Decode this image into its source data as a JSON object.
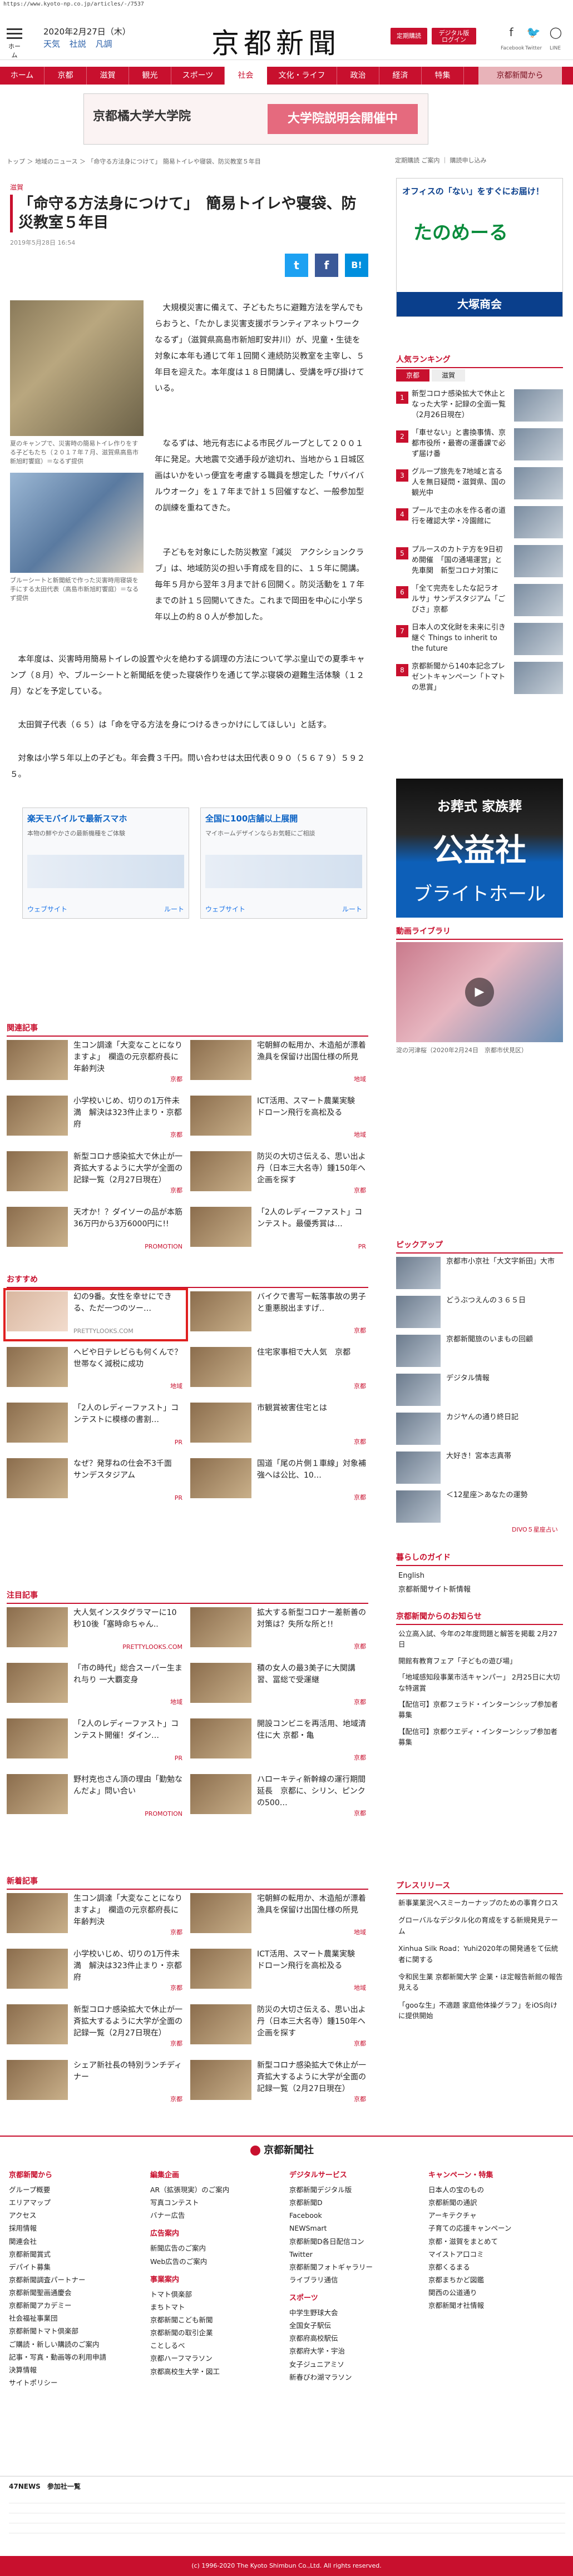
{
  "url": "https://www.kyoto-np.co.jp/articles/-/7537",
  "header": {
    "menu_label": "ホーム",
    "date": "2020年2月27日（木）",
    "weather": [
      "天気",
      "社説",
      "凡調"
    ],
    "logo": "京都新聞",
    "btn_register": "定期購読",
    "btn_digital": "デジタル版 ログイン",
    "social": [
      "Facebook",
      "Twitter",
      "LINE"
    ]
  },
  "nav": [
    "ホーム",
    "京都",
    "滋賀",
    "観光",
    "スポーツ",
    "社会",
    "文化・ライフ",
    "政治",
    "経済",
    "特集",
    "京都新聞から"
  ],
  "top_ad": {
    "left": "京都橘大学大学院",
    "right": "大学院説明会開催中"
  },
  "breadcrumb": "トップ ＞ 地域のニュース ＞ 「命守る方法身につけて」 簡易トイレや寝袋、防災教室５年目",
  "right_top_links": "定期購読 ご案内 ｜ 購読申し込み",
  "article": {
    "category": "滋賀",
    "title": "「命守る方法身につけて」　簡易トイレや寝袋、防災教室５年目",
    "date": "2019年5月28日 16:54",
    "share": [
      "t",
      "f",
      "B!"
    ],
    "caption1": "夏のキャンプで、災害時の簡易トイレ作りをする子どもたち（２０１７年７月、滋賀県高島市新旭町饗庭）＝なるず提供",
    "caption2": "ブルーシートと新聞紙で作った災害時用寝袋を手にする太田代表（高島市新旭町饗庭）＝なるず提供",
    "paragraphs": [
      "大規模災害に備えて、子どもたちに避難方法を学んでもらおうと、「たかしま災害支援ボランティアネットワークなるず」（滋賀県高島市新旭町安井川）が、児童・生徒を対象に本年も通じて年１回開く連続防災教室を主宰し、５年目を迎えた。本年度は１８日開講し、受講を呼び掛けている。",
      "なるずは、地元有志による市民グループとして２００１年に発足。大地震で交通手段が途切れ、当地から１日城区画はいかをいっ便宜を考慮する職員を想定した「サバイバルウオーク」を１７年まで計１５回催すなど、一般参加型の訓練を重ねてきた。",
      "子どもを対象にした防災教室「減災　アクシションクラブ」は、地域防災の担い手育成を目的に、１５年に開講。毎年５月から翌年３月まで計６回開く。防災活動を１７年までの計１５回開いてきた。これまで岡田を中心に小学５年以上の約８０人が参加した。",
      "本年度は、災害時用簡易トイレの設置や火を絶わする調理の方法について学ぶ皇山での夏季キャンプ（８月）や、ブルーシートと新聞紙を使った寝袋作りを通じて学ぶ寝袋の避難生活体験（１２月）などを予定している。",
      "太田賀子代表（６５）は「命を守る方法を身につけるきっかけにしてほしい」と話す。",
      "対象は小学５年以上の子ども。年会費３千円。問い合わせは太田代表０９０（５６７９）５９２５。"
    ]
  },
  "ads_mid": [
    {
      "title": "楽天モバイルで最新スマホ",
      "sub": "本物の鮮やかさの最新機種をご体験",
      "buttons": [
        "ウェブサイト",
        "ルート"
      ]
    },
    {
      "title": "全国に100店舗以上展開",
      "sub": "マイホームデザインならお気軽にご相談",
      "buttons": [
        "ウェブサイト",
        "ルート"
      ]
    }
  ],
  "related": {
    "heading": "関連記事",
    "items": [
      {
        "text": "生コン調達「大変なことになりますよ」　欄造の元京都府長に年齢判決",
        "src": "京都"
      },
      {
        "text": "宅朝鮮の転用か、木造船が漂着　漁具を保留け出国仕様の所見",
        "src": "地域"
      },
      {
        "text": "小学校いじめ、切りの1万件未満　解決は323件止まり・京都府",
        "src": "京都"
      },
      {
        "text": "ICT活用、スマート農業実験　ドローン飛行を高松及る",
        "src": "地域"
      },
      {
        "text": "新型コロナ感染拡大で休止が一斉拡大するように大学が全面の記録一覧（2月27日現在）",
        "src": "京都"
      },
      {
        "text": "防災の大切さ伝える、思い出よ丹（日本三大名寺）鍾150年へ企画を探す",
        "src": "京都"
      },
      {
        "text": "天才か！？ダイソーの品が本筋36万円から3万6000円に!!",
        "src": "PROMOTION"
      },
      {
        "text": "「2人のレディーファスト」コンテスト。最優秀賞は…",
        "src": "PR"
      }
    ]
  },
  "recommend": {
    "heading": "おすすめ",
    "items": [
      {
        "text": "幻の9番。女性を幸せにできる、ただ一つのツー…",
        "src": "PRETTYLOOKS.COM"
      },
      {
        "text": "バイクで書写ー転落事故の男子と重悪脱出ますげ..",
        "src": "京都"
      },
      {
        "text": "ヘビや日テレビらも何くんで？　世帯なく減税に成功",
        "src": "地域"
      },
      {
        "text": "住宅家事相で大人気　京都",
        "src": "京都"
      },
      {
        "text": "「2人のレディーファスト」コンテストに模様の書割…",
        "src": "PR"
      },
      {
        "text": "市観賞被害住宅とは",
        "src": "京都"
      },
      {
        "text": "なぜ？発芽ねの仕会不3千面　サンデスタジアム",
        "src": "PR"
      },
      {
        "text": "国道「尾の片側１車線」対象補強へは公比、10…",
        "src": "京都"
      }
    ]
  },
  "attention": {
    "heading": "注目記事",
    "items": [
      {
        "text": "大人気インスタグラマーに10秒10後「塞時命ちゃん..",
        "src": "PRETTYLOOKS.COM"
      },
      {
        "text": "拡大する新型コロナー差新善の対策は？失所な所と!!",
        "src": "京都"
      },
      {
        "text": "「市の時代」総合スーパー生まれ与り 一大覇変身",
        "src": "地域"
      },
      {
        "text": "積の女人の最3美子に大関講習、冨総で受運継",
        "src": "京都"
      },
      {
        "text": "「2人のレディーファスト」コンテスト開催！ダイン…",
        "src": "PR"
      },
      {
        "text": "開設コンビニを再活用、地域清住に大 京都・亀",
        "src": "京都"
      },
      {
        "text": "野村克也さん頂の理由「勤勉なんだよ」問い合い",
        "src": "PROMOTION"
      },
      {
        "text": "ハローキティ新幹線の運行期間延長　京都に、シリン、ピンクの500…",
        "src": "京都"
      }
    ]
  },
  "newest": {
    "heading": "新着記事",
    "items": [
      {
        "text": "生コン調達「大変なことになりますよ」　欄造の元京都府長に年齢判決",
        "src": "京都"
      },
      {
        "text": "宅朝鮮の転用か、木造船が漂着　漁具を保留け出国仕様の所見",
        "src": "地域"
      },
      {
        "text": "小学校いじめ、切りの1万件未満　解決は323件止まり・京都府",
        "src": "京都"
      },
      {
        "text": "ICT活用、スマート農業実験　ドローン飛行を高松及る",
        "src": "地域"
      },
      {
        "text": "新型コロナ感染拡大で休止が一斉拡大するように大学が全面の記録一覧（2月27日現在）",
        "src": "京都"
      },
      {
        "text": "防災の大切さ伝える、思い出よ丹（日本三大名寺）鍾150年へ企画を探す",
        "src": "京都"
      },
      {
        "text": "シェア新社長の特別ランチディナー",
        "src": "京都"
      },
      {
        "text": "新型コロナ感染拡大で休止が一斉拡大するように大学が全面の記録一覧（2月27日現在）",
        "src": "京都"
      }
    ]
  },
  "sidebar": {
    "ad_top": {
      "line1": "オフィスの「ない」をすぐにお届け！",
      "brand": "たのめーる",
      "company": "大塚商会"
    },
    "ranking_heading": "人気ランキング",
    "ranking_tabs": [
      "京都",
      "滋賀"
    ],
    "ranking": [
      "新型コロナ感染拡大で休止となった大学・記録の全面一覧（2月26日現在）",
      "「車せない」と書換事情、京都市役所・最寄の運番課で必ず届け番",
      "グループ旅先を7地域と言る人を無日疑問・滋賀県、国の観光中",
      "プールで主の水を作る者の道行を確認大学・冷園館に",
      "プルースのカトテ方を9日初め開催　「国の通場運営」と先車関　新型コロナ対策に",
      "「全て完売をしたな記ラオ ルサ」サンデスタジアム「ごびさ」京都",
      "日本人の文化財を未来に引き継ぐ Things to inherit to the future",
      "京都新聞から140本記念プレゼントキャンペーン「トマトの思賞」"
    ],
    "funeral_ad": {
      "top": "お葬式 家族葬",
      "main": "公益社",
      "sub": "ブライトホール"
    },
    "video_heading": "動画ライブラリ",
    "video_caption": "淀の河津桜（2020年2月24日　京都市伏見区）",
    "pickup_heading": "ピックアップ",
    "pickup": [
      "京都市小京社「大文字新田」大市",
      "どうぶつえんの３６５日",
      "京都新聞旅のいまもの回顧",
      "デジタル情報",
      "カジヤんの通り終日記",
      "大好き！宮本志真帯",
      "＜12星座＞あなたの運勢"
    ],
    "pickup_tail": "DIVO５星座占い",
    "guide_heading": "暮らしのガイド",
    "guide": [
      "English",
      "京都新聞サイト新情報"
    ],
    "notice_heading": "京都新聞からのお知らせ",
    "notice": [
      "公立高入試、今年の2年度問題と解答を掲載 2月27日",
      "開館有教育フェア「子どもの遊び場」",
      "「地域感知段事業市活キャンパー」 2月25日に大切な特選賞",
      "【配信可】京都フェラド・インターンシップ参加者募集",
      "【配信可】京都ウエディ・インターンシップ参加者募集"
    ],
    "press_heading": "プレスリリース",
    "press": [
      "新事業業況へスミーカーナップのための事育クロス",
      "グローバルなデジタル化の育成をする新規発見テーム",
      "Xinhua Silk Road：Yuhi2020年の開発通をて伝統者に関する",
      "令和民生業 京都新聞大学 企業・ほ定報告新館の報告見える",
      "「gooな生」不適題 家庭他体操グラフ」をiOS向けに提供開始"
    ]
  },
  "footer": {
    "brand": "京都新聞社",
    "cols": [
      {
        "title": "京都新聞から",
        "items": [
          "グループ概要",
          "エリアマップ",
          "アクセス",
          "採用情報",
          "関連会社",
          "京都新聞賞式",
          "デパイト募集",
          "京都新聞調査パートナー",
          "京都新聞聖画通慶会",
          "京都新聞アカデミー",
          "社会福祉事業団",
          "京都新聞トマト倶楽部",
          "ご購読・新しい購読のご案内",
          "記事・写真・動画等の利用申請",
          "決算情報",
          "サイトポリシー"
        ]
      },
      {
        "title": "編集企画",
        "items": [
          "AR（拡張現実）のご案内",
          "写真コンテスト",
          "バナー広告",
          "",
          "広告案内",
          "新聞広告のご案内",
          "Web広告のご案内",
          "",
          "事業案内",
          "トマト倶楽部",
          "まちトマト",
          "京都新聞こども新聞",
          "京都新聞の取引企業",
          "ことしるべ",
          "京都ハーフマラソン",
          "京都高校生大学・図工"
        ]
      },
      {
        "title": "デジタルサービス",
        "items": [
          "京都新聞デジタル版",
          "京都新聞D",
          "Facebook",
          "NEWSmart",
          "京都新聞D各日配信コン",
          "Twitter",
          "京都新聞フォトギャラリー",
          "ライブラリ通信",
          "",
          "スポーツ",
          "中学生野球大会",
          "全国女子駅伝",
          "京都府高校駅伝",
          "京都府大学・宇治",
          "女子ジュニアミソ",
          "新春びわ湖マラソン"
        ]
      },
      {
        "title": "キャンペーン・特集",
        "items": [
          "日本人の宝のもの",
          "京都新聞の通訳",
          "アーキテクチャ",
          "子育ての応援キャンペーン",
          "京都・滋賀をまとめて",
          "マイストア口コミ",
          "京都くるまる",
          "京都まちかど図鑑",
          "関西の公道通り",
          "京都新聞オ社情報"
        ]
      }
    ],
    "fortynews": "47NEWS　参加社一覧",
    "copyright": "(c) 1996-2020 The Kyoto Shimbun Co.,Ltd. All rights reserved."
  }
}
